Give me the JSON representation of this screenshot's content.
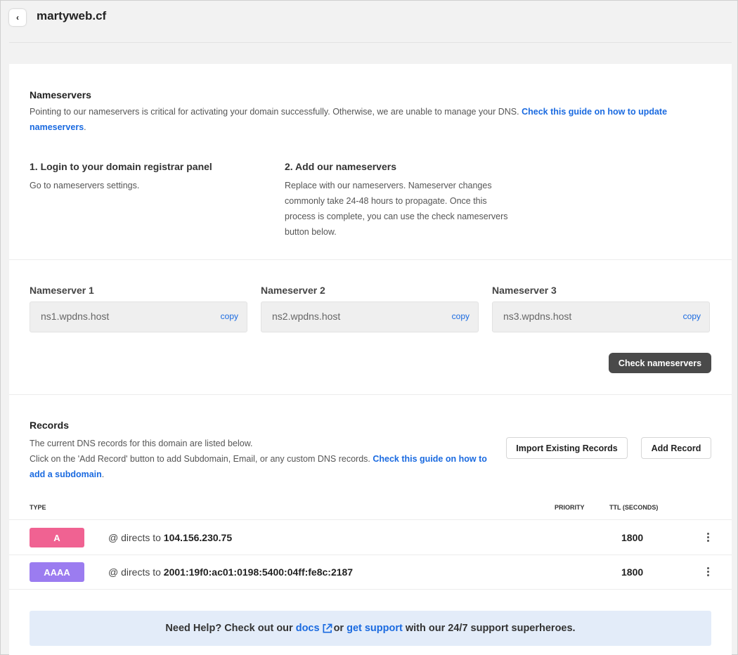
{
  "header": {
    "back_icon": "‹",
    "domain": "martyweb.cf"
  },
  "nameservers_intro": {
    "title": "Nameservers",
    "desc": "Pointing to our nameservers is critical for activating your domain successfully. Otherwise, we are unable to manage your DNS.",
    "link_part1": "Check this guide on how to update",
    "link_part2": "nameservers",
    "end": "."
  },
  "steps": [
    {
      "title": "1. Login to your domain registrar panel",
      "lines": [
        "Go to nameservers settings."
      ]
    },
    {
      "title": "2. Add our nameservers",
      "lines": [
        "Replace with our nameservers. Nameserver changes",
        "commonly take 24-48 hours to propagate. Once this",
        "process is complete, you can use the check nameservers",
        "button below."
      ]
    }
  ],
  "nameservers": [
    {
      "label": "Nameserver 1",
      "value": "ns1.wpdns.host",
      "copy": "copy"
    },
    {
      "label": "Nameserver 2",
      "value": "ns2.wpdns.host",
      "copy": "copy"
    },
    {
      "label": "Nameserver 3",
      "value": "ns3.wpdns.host",
      "copy": "copy"
    }
  ],
  "check_button": "Check nameservers",
  "records": {
    "title": "Records",
    "line1": "The current DNS records for this domain are listed below.",
    "line2": "Click on the 'Add Record' button to add Subdomain, Email, or any custom DNS records.",
    "link_part1": "Check this guide on how",
    "link_part2": "to add a subdomain",
    "end": ".",
    "import_button": "Import Existing Records",
    "add_button": "Add Record",
    "columns": {
      "type": "TYPE",
      "priority": "PRIORITY",
      "ttl": "TTL (SECONDS)"
    },
    "rows": [
      {
        "type": "A",
        "color": "#f06292",
        "prefix": "@ directs to",
        "target": "104.156.230.75",
        "ttl": "1800"
      },
      {
        "type": "AAAA",
        "color": "#9b7cf0",
        "prefix": "@ directs to",
        "target": "2001:19f0:ac01:0198:5400:04ff:fe8c:2187",
        "ttl": "1800"
      }
    ]
  },
  "help": {
    "prefix": "Need Help? Check out our",
    "docs": "docs",
    "or": "or",
    "support": "get support",
    "suffix": "with our 24/7 support superheroes."
  },
  "colors": {
    "link": "#1a6ae0",
    "help_bg": "#e3ecf9",
    "dark_button": "#4a4a4a"
  }
}
